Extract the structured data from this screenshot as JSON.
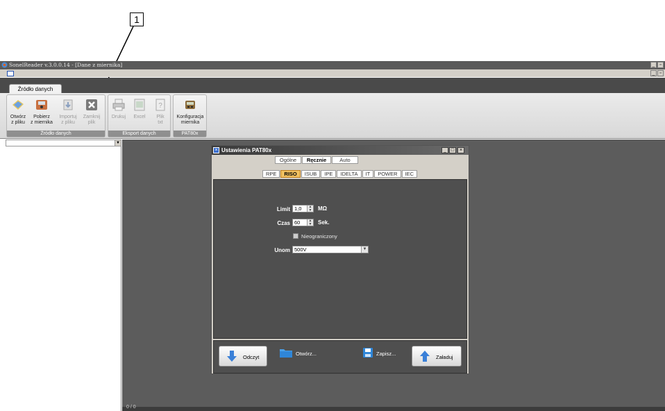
{
  "callout": {
    "number": "1"
  },
  "window": {
    "title": "SonelReader   v.3.0.0.14 - [Dane z miernika]"
  },
  "ribbon": {
    "tab": "Źródło danych",
    "groups": [
      {
        "label": "Źródło danych",
        "buttons": [
          {
            "label": "Otwórz\nz pliku",
            "icon": "open-file-icon",
            "enabled": true
          },
          {
            "label": "Pobierz\nz miernika",
            "icon": "download-meter-icon",
            "enabled": true
          },
          {
            "label": "Importuj\nz pliku",
            "icon": "import-icon",
            "enabled": false
          },
          {
            "label": "Zamknij\nplik",
            "icon": "close-file-icon",
            "enabled": false
          }
        ]
      },
      {
        "label": "Eksport danych",
        "buttons": [
          {
            "label": "Drukuj",
            "icon": "print-icon",
            "enabled": false
          },
          {
            "label": "Excel",
            "icon": "excel-icon",
            "enabled": false
          },
          {
            "label": "Plik\ntxt",
            "icon": "txt-file-icon",
            "enabled": false
          }
        ]
      },
      {
        "label": "PAT80x",
        "buttons": [
          {
            "label": "Konfiguracja\nmiernika",
            "icon": "meter-config-icon",
            "enabled": true
          }
        ]
      }
    ]
  },
  "status": {
    "text": "0 / 0"
  },
  "dialog": {
    "title": "Ustawienia PAT80x",
    "mode_tabs": [
      "Ogólne",
      "Ręcznie",
      "Auto"
    ],
    "active_mode": "Ręcznie",
    "measure_tabs": [
      "RPE",
      "RISO",
      "ISUB",
      "IPE",
      "IDELTA",
      "IT",
      "POWER",
      "IEC"
    ],
    "active_measure": "RISO",
    "fields": {
      "limit": {
        "label": "Limit",
        "value": "1,0",
        "unit": "MΩ"
      },
      "czas": {
        "label": "Czas",
        "value": "60",
        "unit": "Sek."
      },
      "unlimited": {
        "label": "Nieograniczony",
        "checked": false
      },
      "unom": {
        "label": "Unom",
        "value": "500V"
      }
    },
    "buttons": {
      "read": "Odczyt",
      "open": "Otwórz...",
      "save": "Zapisz...",
      "load": "Załaduj"
    }
  },
  "colors": {
    "accent": "#3a6fd0",
    "selected_tab": "#f0c060"
  }
}
